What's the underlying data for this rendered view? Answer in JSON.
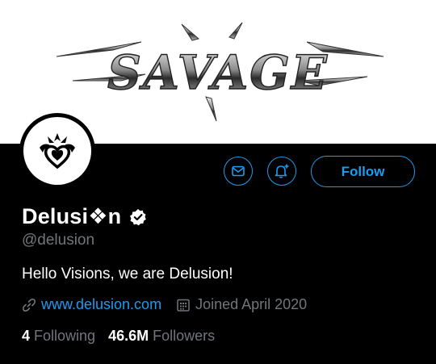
{
  "banner": {
    "logo_text": "SAVAGE"
  },
  "profile": {
    "display_name": "Delusi❖n",
    "handle": "@delusion",
    "bio": "Hello Visions, we are Delusion!",
    "website": "www.delusion.com",
    "joined": "Joined April 2020",
    "following_count": "4",
    "following_label": "Following",
    "followers_count": "46.6M",
    "followers_label": "Followers"
  },
  "actions": {
    "follow_label": "Follow"
  },
  "icons": {
    "message": "envelope-icon",
    "notify": "bell-plus-icon",
    "verified": "verified-badge-icon",
    "link": "link-icon",
    "calendar": "calendar-icon",
    "avatar": "heart-crest-icon"
  },
  "colors": {
    "accent": "#1d9bf0",
    "muted": "#71767b",
    "background": "#000000"
  }
}
